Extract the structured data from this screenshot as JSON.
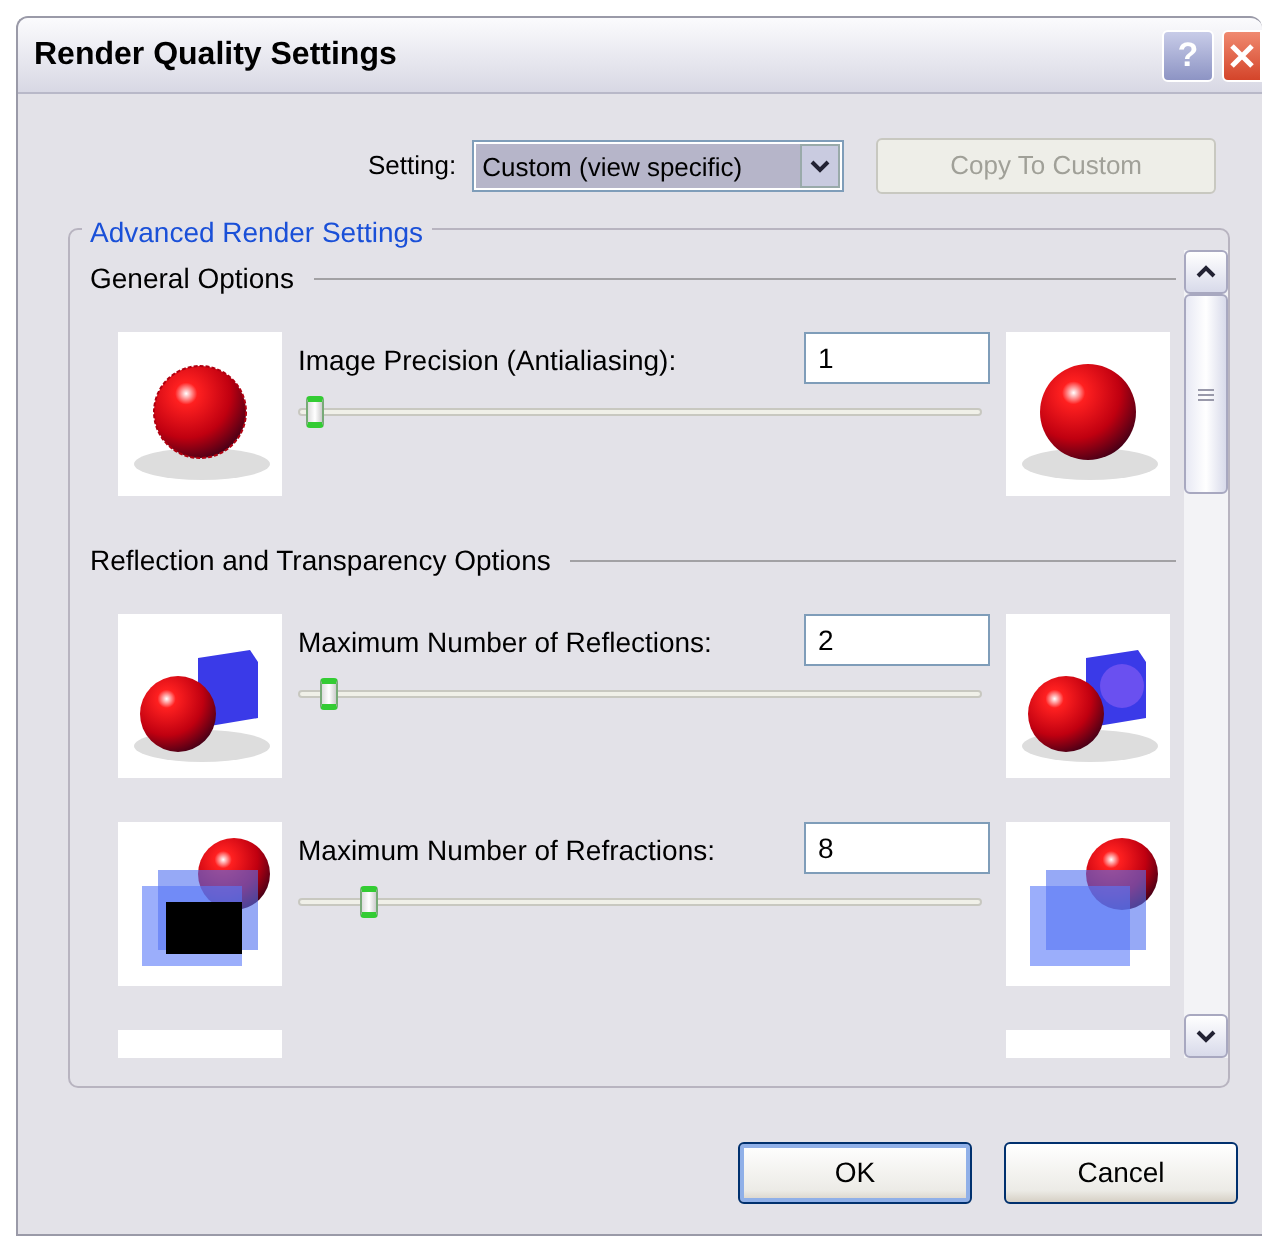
{
  "window": {
    "title": "Render Quality Settings",
    "help": "?"
  },
  "setting": {
    "label": "Setting:",
    "value": "Custom (view specific)",
    "copy_button": {
      "label": "Copy To Custom",
      "disabled": true
    }
  },
  "group": {
    "title": "Advanced Render Settings",
    "sections": [
      {
        "title": "General Options",
        "options": [
          {
            "label": "Image Precision (Antialiasing):",
            "value": "1",
            "level": 0.01,
            "kind": "sphere"
          }
        ]
      },
      {
        "title": "Reflection and Transparency Options",
        "options": [
          {
            "label": "Maximum Number of Reflections:",
            "value": "2",
            "level": 0.03,
            "kind": "reflection"
          },
          {
            "label": "Maximum Number of Refractions:",
            "value": "8",
            "level": 0.09,
            "kind": "refraction"
          },
          {
            "kind": "blank"
          }
        ]
      }
    ]
  },
  "buttons": [
    {
      "label": "OK",
      "default": true
    },
    {
      "label": "Cancel",
      "default": false
    }
  ]
}
